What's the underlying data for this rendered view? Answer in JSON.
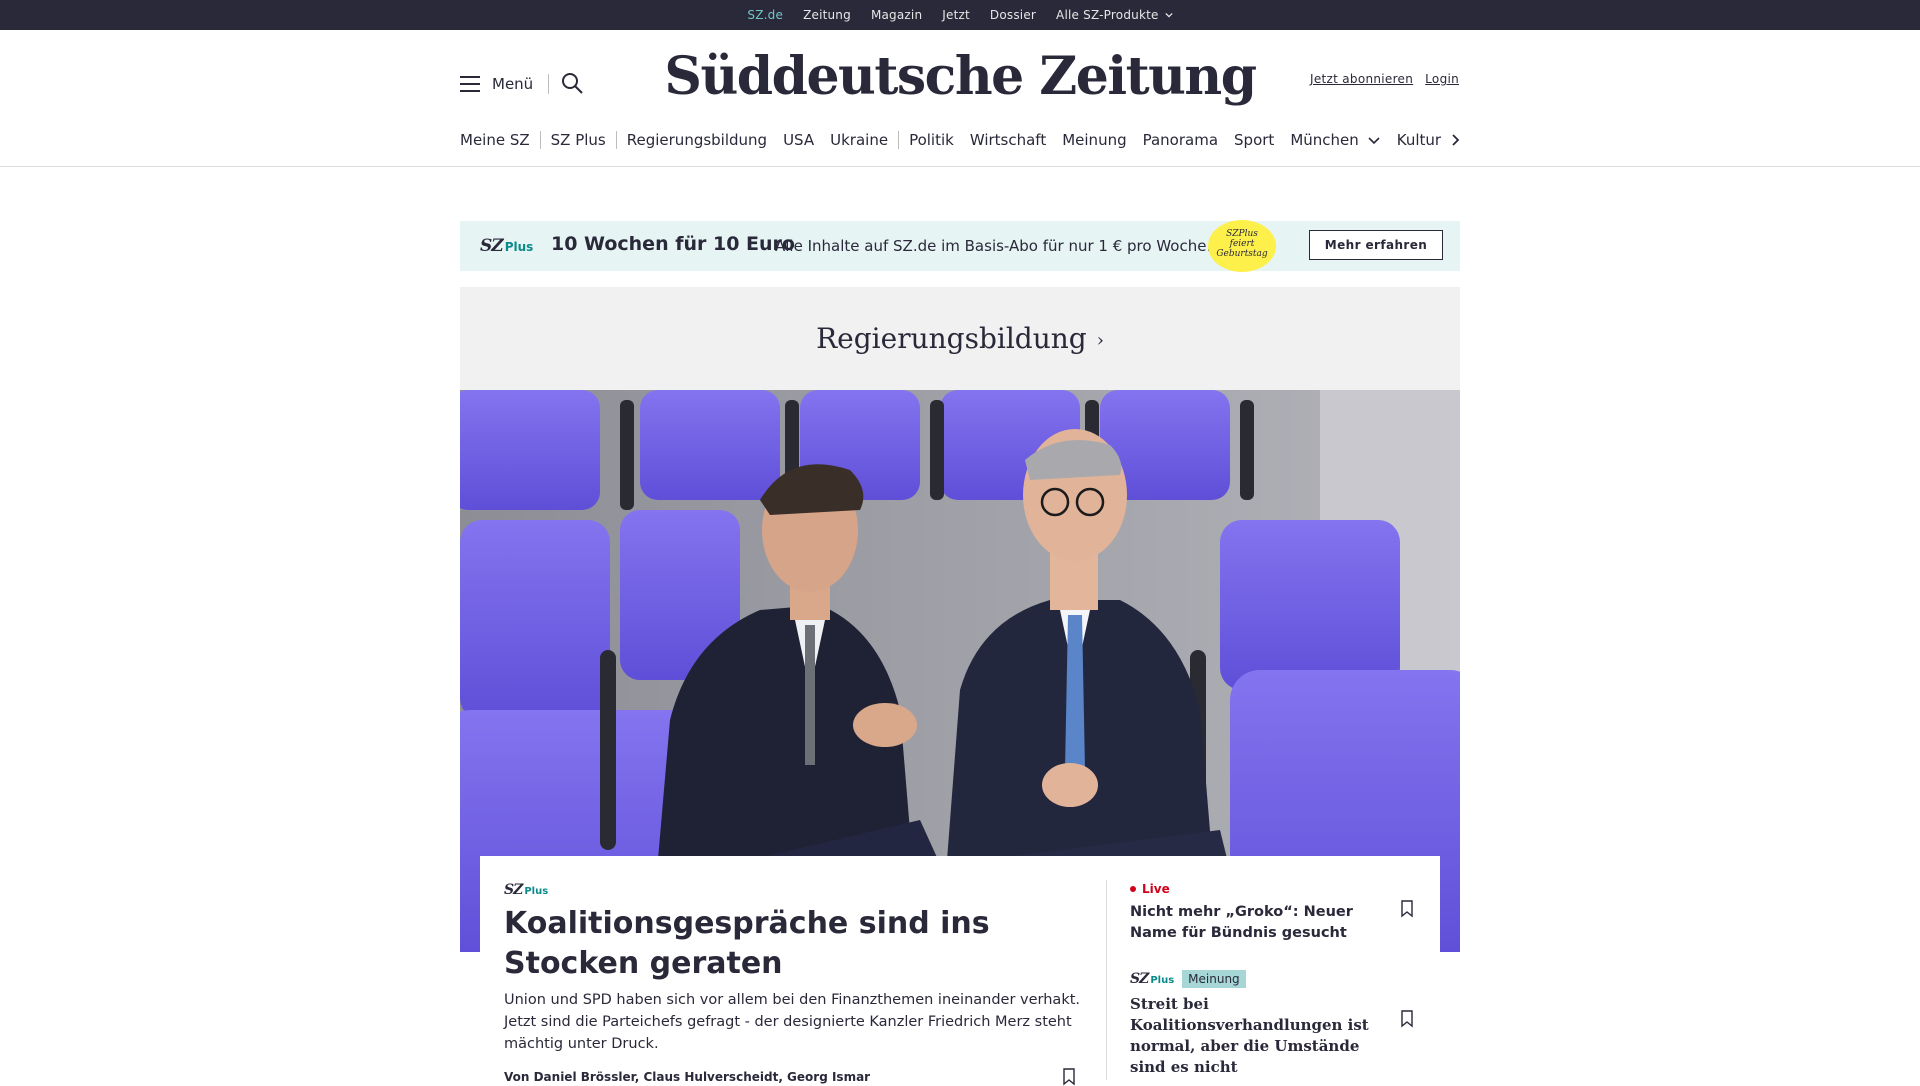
{
  "topbar": {
    "items": [
      "SZ.de",
      "Zeitung",
      "Magazin",
      "Jetzt",
      "Dossier",
      "Alle SZ-Produkte"
    ],
    "active_index": 0
  },
  "header": {
    "menu_label": "Menü",
    "logo_text": "Süddeutsche Zeitung",
    "subscribe_label": "Jetzt abonnieren",
    "login_label": "Login"
  },
  "nav": {
    "items": [
      "Meine SZ",
      "SZ Plus",
      "Regierungsbildung",
      "USA",
      "Ukraine",
      "Politik",
      "Wirtschaft",
      "Meinung",
      "Panorama",
      "Sport",
      "München",
      "Kultur"
    ]
  },
  "promo": {
    "logo_sz": "SZ",
    "logo_plus": "Plus",
    "title": "10 Wochen für 10 Euro",
    "text": "Alle Inhalte auf SZ.de im Basis-Abo für nur 1 € pro Woche.",
    "badge_line1": "SZPlus",
    "badge_line2": "feiert",
    "badge_line3": "Geburtstag",
    "button_label": "Mehr erfahren"
  },
  "section": {
    "title": "Regierungsbildung"
  },
  "lead": {
    "logo_sz": "SZ",
    "logo_plus": "Plus",
    "title": "Koalitionsgespräche sind ins Stocken geraten",
    "text": "Union und SPD haben sich vor allem bei den Finanzthemen ineinander verhakt. Jetzt sind die Parteichefs gefragt - der designierte Kanzler Friedrich Merz steht mächtig unter Druck.",
    "authors": "Von Daniel Brössler, Claus Hulverscheidt, Georg Ismar"
  },
  "side": {
    "live_label": "Live",
    "item1_title": "Nicht mehr „Groko“: Neuer Name für Bündnis gesucht",
    "item2_logo_sz": "SZ",
    "item2_logo_plus": "Plus",
    "item2_badge": "Meinung",
    "item2_title": "Streit bei Koalitionsverhandlungen ist normal, aber die Umstände sind es nicht"
  },
  "colors": {
    "dark": "#29293a",
    "accent_teal": "#0a8a8a",
    "promo_bg": "#e7f4f4",
    "badge_yellow": "#fdf04b",
    "live_red": "#d0021b",
    "seat_purple": "#6f5fe6"
  },
  "icons": {
    "menu": "hamburger-icon",
    "search": "search-icon",
    "nav_next": "chevron-right-icon",
    "dropdown": "chevron-down-icon",
    "bookmark": "bookmark-icon"
  }
}
